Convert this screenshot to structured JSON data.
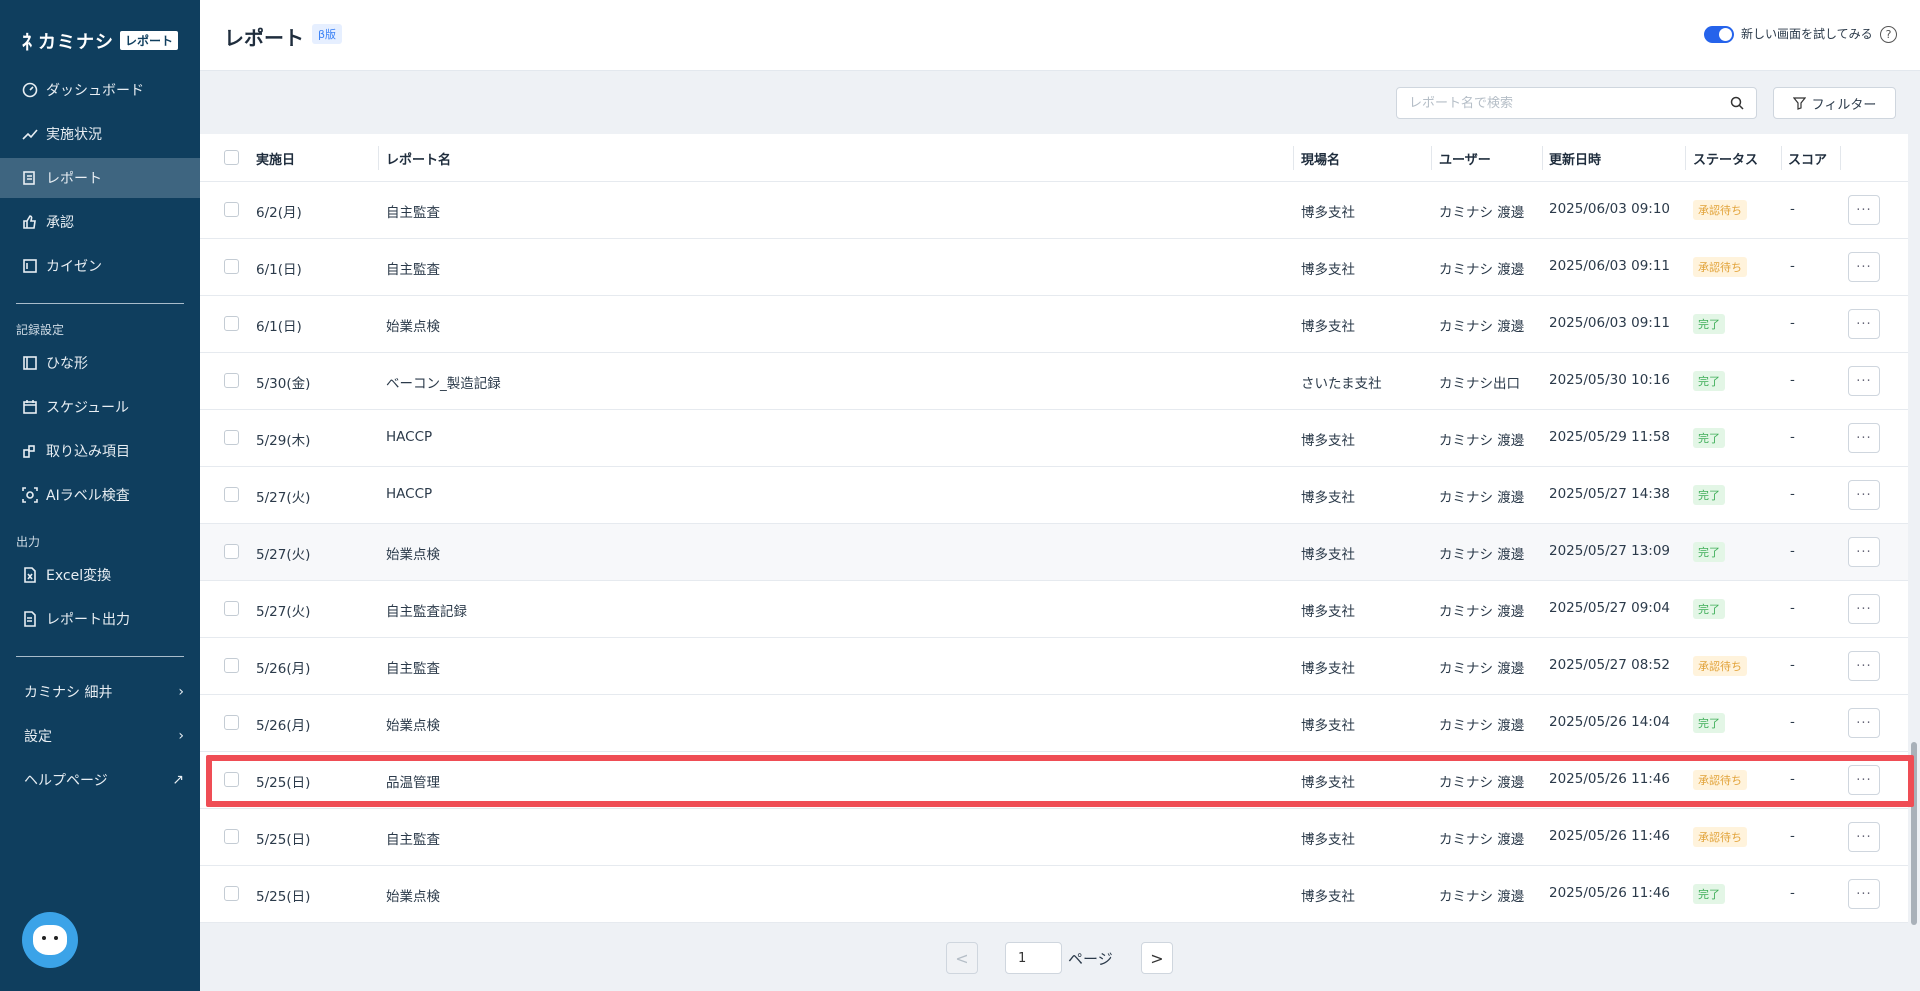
{
  "app": {
    "logo_text": "カミナシ",
    "logo_badge": "レポート"
  },
  "sidebar": {
    "items": [
      {
        "label": "ダッシュボード",
        "icon": "dashboard-icon"
      },
      {
        "label": "実施状況",
        "icon": "trend-icon"
      },
      {
        "label": "レポート",
        "icon": "report-icon",
        "active": true
      },
      {
        "label": "承認",
        "icon": "thumbs-up-icon"
      },
      {
        "label": "カイゼン",
        "icon": "kaizen-icon"
      }
    ],
    "section_record": "記録設定",
    "record_items": [
      {
        "label": "ひな形",
        "icon": "template-icon"
      },
      {
        "label": "スケジュール",
        "icon": "calendar-icon"
      },
      {
        "label": "取り込み項目",
        "icon": "import-icon"
      },
      {
        "label": "AIラベル検査",
        "icon": "ai-scan-icon"
      }
    ],
    "section_output": "出力",
    "output_items": [
      {
        "label": "Excel変換",
        "icon": "excel-icon"
      },
      {
        "label": "レポート出力",
        "icon": "export-icon"
      }
    ],
    "bottom_links": [
      {
        "label": "カミナシ 細井",
        "icon": "chevron-right-icon"
      },
      {
        "label": "設定",
        "icon": "chevron-right-icon"
      },
      {
        "label": "ヘルプページ",
        "icon": "external-link-icon"
      }
    ]
  },
  "header": {
    "title": "レポート",
    "beta_badge": "β版",
    "toggle_label": "新しい画面を試してみる",
    "help": "?"
  },
  "toolbar": {
    "search_placeholder": "レポート名で検索",
    "filter_label": "フィルター"
  },
  "table": {
    "columns": [
      "実施日",
      "レポート名",
      "現場名",
      "ユーザー",
      "更新日時",
      "ステータス",
      "スコア"
    ],
    "rows": [
      {
        "date": "6/2(月)",
        "name": "自主監査",
        "site": "博多支社",
        "user": "カミナシ 渡邊",
        "updated": "2025/06/03 09:10",
        "status": "承認待ち",
        "status_type": "pending",
        "score": "-"
      },
      {
        "date": "6/1(日)",
        "name": "自主監査",
        "site": "博多支社",
        "user": "カミナシ 渡邊",
        "updated": "2025/06/03 09:11",
        "status": "承認待ち",
        "status_type": "pending",
        "score": "-"
      },
      {
        "date": "6/1(日)",
        "name": "始業点検",
        "site": "博多支社",
        "user": "カミナシ 渡邊",
        "updated": "2025/06/03 09:11",
        "status": "完了",
        "status_type": "done",
        "score": "-"
      },
      {
        "date": "5/30(金)",
        "name": "ベーコン_製造記録",
        "site": "さいたま支社",
        "user": "カミナシ出口",
        "updated": "2025/05/30 10:16",
        "status": "完了",
        "status_type": "done",
        "score": "-"
      },
      {
        "date": "5/29(木)",
        "name": "HACCP",
        "site": "博多支社",
        "user": "カミナシ 渡邊",
        "updated": "2025/05/29 11:58",
        "status": "完了",
        "status_type": "done",
        "score": "-"
      },
      {
        "date": "5/27(火)",
        "name": "HACCP",
        "site": "博多支社",
        "user": "カミナシ 渡邊",
        "updated": "2025/05/27 14:38",
        "status": "完了",
        "status_type": "done",
        "score": "-"
      },
      {
        "date": "5/27(火)",
        "name": "始業点検",
        "site": "博多支社",
        "user": "カミナシ 渡邊",
        "updated": "2025/05/27 13:09",
        "status": "完了",
        "status_type": "done",
        "score": "-"
      },
      {
        "date": "5/27(火)",
        "name": "自主監査記録",
        "site": "博多支社",
        "user": "カミナシ 渡邊",
        "updated": "2025/05/27 09:04",
        "status": "完了",
        "status_type": "done",
        "score": "-"
      },
      {
        "date": "5/26(月)",
        "name": "自主監査",
        "site": "博多支社",
        "user": "カミナシ 渡邊",
        "updated": "2025/05/27 08:52",
        "status": "承認待ち",
        "status_type": "pending",
        "score": "-"
      },
      {
        "date": "5/26(月)",
        "name": "始業点検",
        "site": "博多支社",
        "user": "カミナシ 渡邊",
        "updated": "2025/05/26 14:04",
        "status": "完了",
        "status_type": "done",
        "score": "-"
      },
      {
        "date": "5/25(日)",
        "name": "品温管理",
        "site": "博多支社",
        "user": "カミナシ 渡邊",
        "updated": "2025/05/26 11:46",
        "status": "承認待ち",
        "status_type": "pending",
        "score": "-"
      },
      {
        "date": "5/25(日)",
        "name": "自主監査",
        "site": "博多支社",
        "user": "カミナシ 渡邊",
        "updated": "2025/05/26 11:46",
        "status": "承認待ち",
        "status_type": "pending",
        "score": "-"
      },
      {
        "date": "5/25(日)",
        "name": "始業点検",
        "site": "博多支社",
        "user": "カミナシ 渡邊",
        "updated": "2025/05/26 11:46",
        "status": "完了",
        "status_type": "done",
        "score": "-"
      }
    ],
    "more_label": "···"
  },
  "pagination": {
    "current_page": "1",
    "page_label": "ページ",
    "prev": "<",
    "next": ">"
  },
  "colors": {
    "sidebar_bg": "#0f3e5e",
    "accent": "#2563eb",
    "highlight": "#ef4d55",
    "pending": "#e2a33a",
    "done": "#3fae59"
  }
}
